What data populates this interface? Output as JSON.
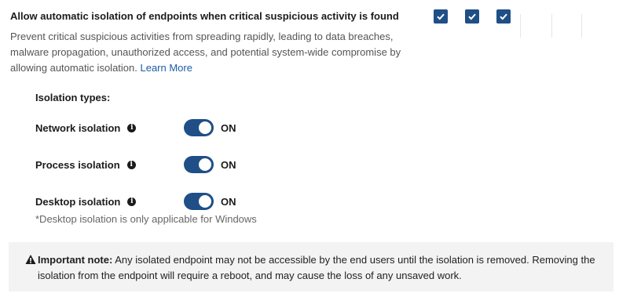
{
  "setting": {
    "title": "Allow automatic isolation of endpoints when critical suspicious activity is found",
    "description": "Prevent critical suspicious activities from spreading rapidly, leading to data breaches, malware propagation, unauthorized access, and potential system-wide compromise by allowing automatic isolation. ",
    "learn_more": "Learn More",
    "checkboxes": [
      {
        "checked": true,
        "icon": "checkmark-icon"
      },
      {
        "checked": true,
        "icon": "checkmark-icon"
      },
      {
        "checked": true,
        "icon": "checkmark-icon"
      }
    ]
  },
  "isolation": {
    "heading": "Isolation types:",
    "types": [
      {
        "label": "Network isolation",
        "state": "ON",
        "enabled": true,
        "icon": "info-icon"
      },
      {
        "label": "Process isolation",
        "state": "ON",
        "enabled": true,
        "icon": "info-icon"
      },
      {
        "label": "Desktop isolation",
        "state": "ON",
        "enabled": true,
        "icon": "info-icon"
      }
    ],
    "footnote": "*Desktop isolation is only applicable for Windows"
  },
  "note": {
    "label": "Important note:",
    "text": " Any isolated endpoint may not be accessible by the end users until the isolation is removed. Removing the isolation from the endpoint will require a reboot, and may cause the loss of any unsaved work.",
    "icon": "warning-icon"
  },
  "colors": {
    "accent": "#1f4f86",
    "link": "#1a5ea8",
    "note_background": "#f3f3f3"
  }
}
